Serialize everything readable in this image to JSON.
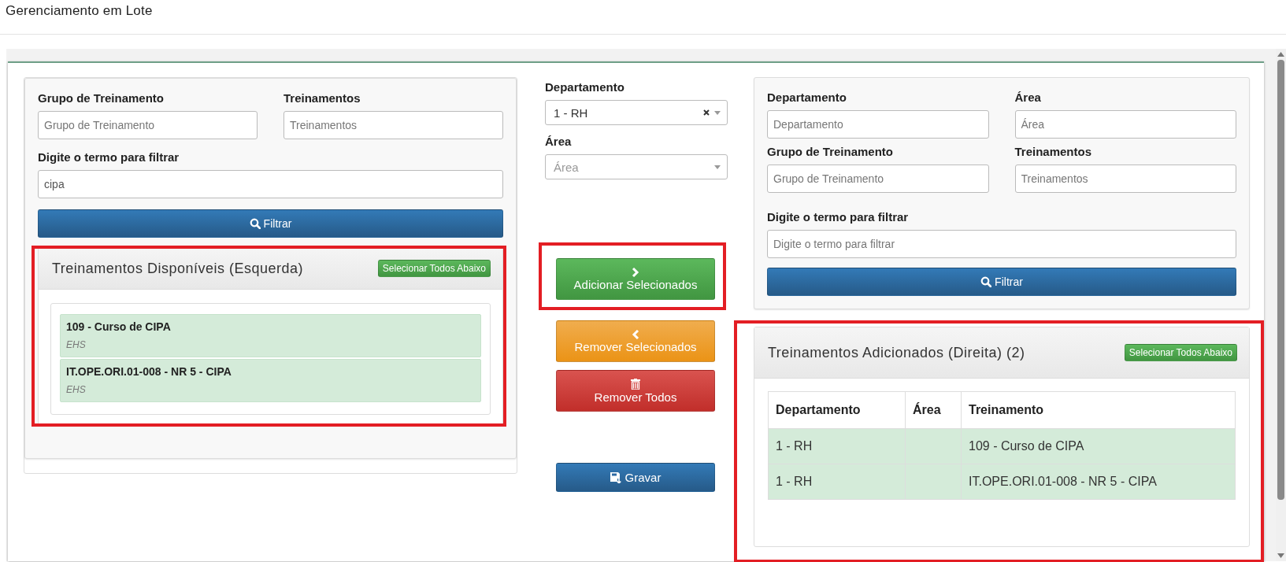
{
  "page_title": "Gerenciamento em Lote",
  "left": {
    "filter_rows": [
      [
        {
          "label": "Grupo de Treinamento",
          "placeholder": "Grupo de Treinamento"
        },
        {
          "label": "Treinamentos",
          "placeholder": "Treinamentos"
        }
      ],
      [
        {
          "label": "Digite o termo para filtrar",
          "value": "cipa"
        }
      ]
    ],
    "filter_button": "Filtrar",
    "list_panel": {
      "title": "Treinamentos Disponíveis (Esquerda)",
      "select_all": "Selecionar Todos Abaixo",
      "highlighted": true,
      "items": [
        {
          "title": "109 - Curso de CIPA",
          "subtitle": "EHS"
        },
        {
          "title": "IT.OPE.ORI.01-008 - NR 5 - CIPA",
          "subtitle": "EHS"
        }
      ]
    }
  },
  "middle": {
    "fields": [
      {
        "label": "Departamento",
        "value": "1 - RH",
        "clearable": true
      },
      {
        "label": "Área",
        "placeholder": "Área",
        "clearable": false
      }
    ],
    "actions": [
      {
        "kind": "add",
        "label": "Adicionar Selecionados",
        "highlighted": true
      },
      {
        "kind": "remove",
        "label": "Remover Selecionados",
        "highlighted": false
      },
      {
        "kind": "remove_all",
        "label": "Remover Todos",
        "highlighted": false
      },
      {
        "kind": "save",
        "label": "Gravar",
        "highlighted": false
      }
    ]
  },
  "right": {
    "filter_rows": [
      [
        {
          "label": "Departamento",
          "placeholder": "Departamento"
        },
        {
          "label": "Área",
          "placeholder": "Área"
        }
      ],
      [
        {
          "label": "Grupo de Treinamento",
          "placeholder": "Grupo de Treinamento"
        },
        {
          "label": "Treinamentos",
          "placeholder": "Treinamentos"
        }
      ],
      [
        {
          "label": "Digite o termo para filtrar",
          "placeholder": "Digite o termo para filtrar"
        }
      ]
    ],
    "filter_button": "Filtrar",
    "table_panel": {
      "title": "Treinamentos Adicionados (Direita) (2)",
      "select_all": "Selecionar Todos Abaixo",
      "highlighted": true,
      "columns": [
        "Departamento",
        "Área",
        "Treinamento"
      ],
      "rows": [
        [
          "1 - RH",
          "",
          "109 - Curso de CIPA"
        ],
        [
          "1 - RH",
          "",
          "IT.OPE.ORI.01-008 - NR 5 - CIPA"
        ]
      ]
    }
  }
}
